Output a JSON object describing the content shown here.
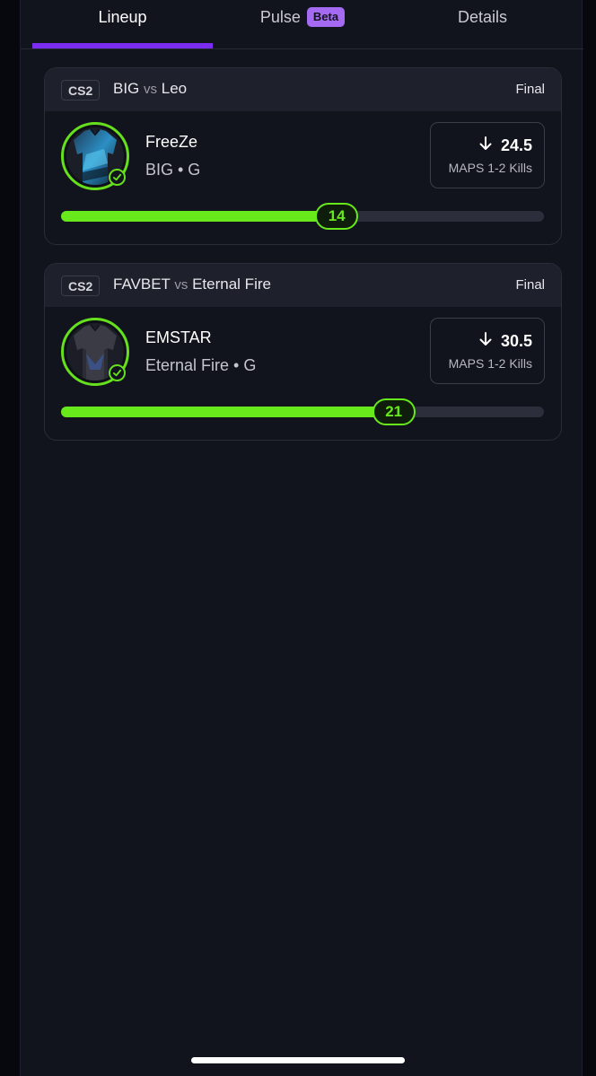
{
  "tabs": [
    {
      "label": "Lineup",
      "active": true
    },
    {
      "label": "Pulse",
      "badge": "Beta",
      "active": false
    },
    {
      "label": "Details",
      "active": false
    }
  ],
  "colors": {
    "accent_purple": "#7a2cf0",
    "beta_badge": "#a46bf2",
    "progress_green": "#67e91b",
    "card_bg": "#11131d",
    "header_bg": "#1e202b"
  },
  "cards": [
    {
      "game": "CS2",
      "team_a": "BIG",
      "vs": "vs",
      "team_b": "Leo",
      "status": "Final",
      "player": {
        "name": "FreeZe",
        "meta": "BIG • G",
        "avatar_icon": "jersey-blue-icon",
        "verified_icon": "check-circle-icon"
      },
      "line": {
        "direction_icon": "arrow-down-icon",
        "value": "24.5",
        "stat": "MAPS 1-2 Kills"
      },
      "progress": {
        "value_label": "14",
        "fraction": 0.571
      }
    },
    {
      "game": "CS2",
      "team_a": "FAVBET",
      "vs": "vs",
      "team_b": "Eternal Fire",
      "status": "Final",
      "player": {
        "name": "EMSTAR",
        "meta": "Eternal Fire • G",
        "avatar_icon": "jersey-dark-icon",
        "verified_icon": "check-circle-icon"
      },
      "line": {
        "direction_icon": "arrow-down-icon",
        "value": "30.5",
        "stat": "MAPS 1-2 Kills"
      },
      "progress": {
        "value_label": "21",
        "fraction": 0.689
      }
    }
  ]
}
